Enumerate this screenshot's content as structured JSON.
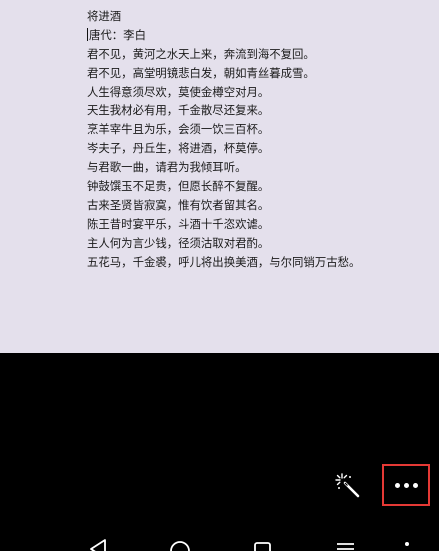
{
  "document": {
    "lines": [
      "将进酒",
      "唐代：李白",
      "君不见，黄河之水天上来，奔流到海不复回。",
      "君不见，高堂明镜悲白发，朝如青丝暮成雪。",
      "人生得意须尽欢，莫使金樽空对月。",
      "天生我材必有用，千金散尽还复来。",
      "烹羊宰牛且为乐，会须一饮三百杯。",
      "岑夫子，丹丘生，将进酒，杯莫停。",
      "与君歌一曲，请君为我倾耳听。",
      "钟鼓馔玉不足贵，但愿长醉不复醒。",
      "古来圣贤皆寂寞，惟有饮者留其名。",
      "陈王昔时宴平乐，斗酒十千恣欢谑。",
      "主人何为言少钱，径须沽取对君酌。",
      "五花马，千金裘，呼儿将出换美酒，与尔同销万古愁。"
    ]
  },
  "toolbar": {
    "wand_icon": "magic-wand-icon",
    "more_icon": "more-horizontal-icon"
  },
  "navigation": {
    "icons": [
      "back-icon",
      "home-icon",
      "recents-icon",
      "menu-icon",
      "dot-icon"
    ]
  },
  "colors": {
    "document_background": "#e4e0ec",
    "panel_background": "#000000",
    "highlight_border": "#e53935",
    "icon": "#ffffff"
  }
}
